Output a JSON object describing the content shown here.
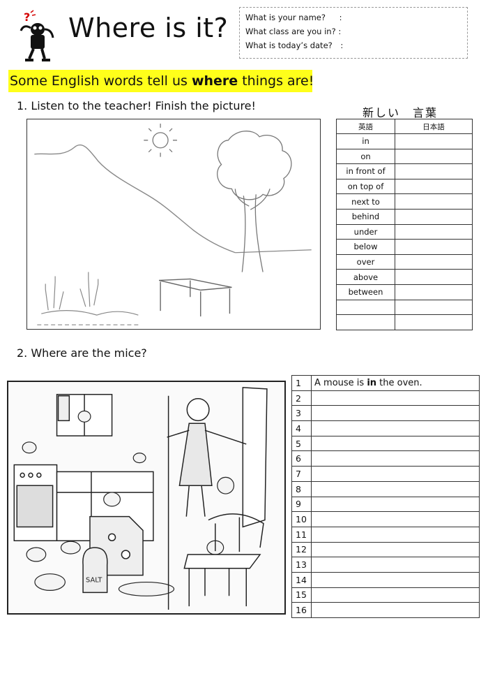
{
  "header": {
    "title": "Where is it?",
    "info_lines": [
      {
        "label": "What is your name?",
        "colon": ":"
      },
      {
        "label": "What class are you in? :",
        "colon": ""
      },
      {
        "label": "What is today’s date?",
        "colon": ":"
      }
    ]
  },
  "banner": {
    "before": "Some English words tell us ",
    "bold": "where",
    "after": " things are!"
  },
  "question1": "1. Listen to the teacher! Finish the picture!",
  "vocab": {
    "title": "新しい　言葉",
    "col_english": "英語",
    "col_japanese": "日本語",
    "words": [
      "in",
      "on",
      "in front of",
      "on top of",
      "next to",
      "behind",
      "under",
      "below",
      "over",
      "above",
      "between",
      "",
      ""
    ]
  },
  "question2": "2. Where are the mice?",
  "mice_answers": {
    "rows": [
      {
        "num": "1",
        "before": "A mouse is ",
        "bold": "in",
        "after": " the oven."
      },
      {
        "num": "2",
        "before": "",
        "bold": "",
        "after": ""
      },
      {
        "num": "3",
        "before": "",
        "bold": "",
        "after": ""
      },
      {
        "num": "4",
        "before": "",
        "bold": "",
        "after": ""
      },
      {
        "num": "5",
        "before": "",
        "bold": "",
        "after": ""
      },
      {
        "num": "6",
        "before": "",
        "bold": "",
        "after": ""
      },
      {
        "num": "7",
        "before": "",
        "bold": "",
        "after": ""
      },
      {
        "num": "8",
        "before": "",
        "bold": "",
        "after": ""
      },
      {
        "num": "9",
        "before": "",
        "bold": "",
        "after": ""
      },
      {
        "num": "10",
        "before": "",
        "bold": "",
        "after": ""
      },
      {
        "num": "11",
        "before": "",
        "bold": "",
        "after": ""
      },
      {
        "num": "12",
        "before": "",
        "bold": "",
        "after": ""
      },
      {
        "num": "13",
        "before": "",
        "bold": "",
        "after": ""
      },
      {
        "num": "14",
        "before": "",
        "bold": "",
        "after": ""
      },
      {
        "num": "15",
        "before": "",
        "bold": "",
        "after": ""
      },
      {
        "num": "16",
        "before": "",
        "bold": "",
        "after": ""
      }
    ]
  },
  "colors": {
    "highlight": "#ffff1a",
    "mascot_red": "#d40000"
  }
}
